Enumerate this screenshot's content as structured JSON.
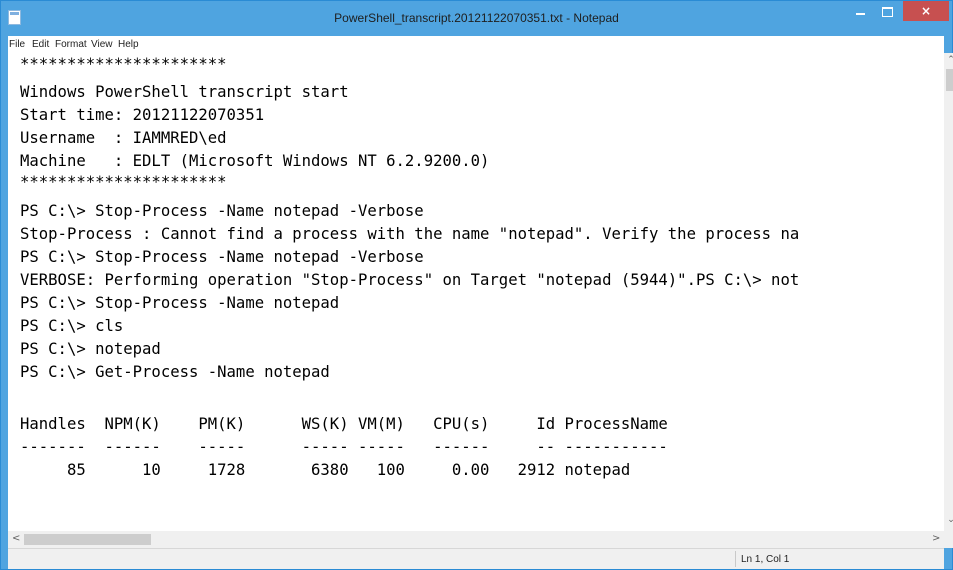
{
  "window": {
    "title": "PowerShell_transcript.20121122070351.txt - Notepad",
    "controls": {
      "minimize": "",
      "maximize": "",
      "close": "×"
    }
  },
  "menu": {
    "items": [
      {
        "label": "File"
      },
      {
        "label": "Edit"
      },
      {
        "label": "Format"
      },
      {
        "label": "View"
      },
      {
        "label": "Help"
      }
    ]
  },
  "editor": {
    "lines": [
      "**********************",
      "Windows PowerShell transcript start",
      "Start time: 20121122070351",
      "Username  : IAMMRED\\ed",
      "Machine   : EDLT (Microsoft Windows NT 6.2.9200.0)",
      "**********************",
      "PS C:\\> Stop-Process -Name notepad -Verbose",
      "Stop-Process : Cannot find a process with the name \"notepad\". Verify the process na",
      "PS C:\\> Stop-Process -Name notepad -Verbose",
      "VERBOSE: Performing operation \"Stop-Process\" on Target \"notepad (5944)\".PS C:\\> not",
      "PS C:\\> Stop-Process -Name notepad",
      "PS C:\\> cls",
      "PS C:\\> notepad",
      "PS C:\\> Get-Process -Name notepad",
      "",
      "Handles  NPM(K)    PM(K)      WS(K) VM(M)   CPU(s)     Id ProcessName",
      "-------  ------    -----      ----- -----   ------     -- -----------",
      "     85      10     1728       6380   100     0.00   2912 notepad"
    ]
  },
  "scrollbars": {
    "up": "⌃",
    "down": "⌄",
    "left": "<",
    "right": ">"
  },
  "status": {
    "position": "Ln 1, Col 1"
  }
}
